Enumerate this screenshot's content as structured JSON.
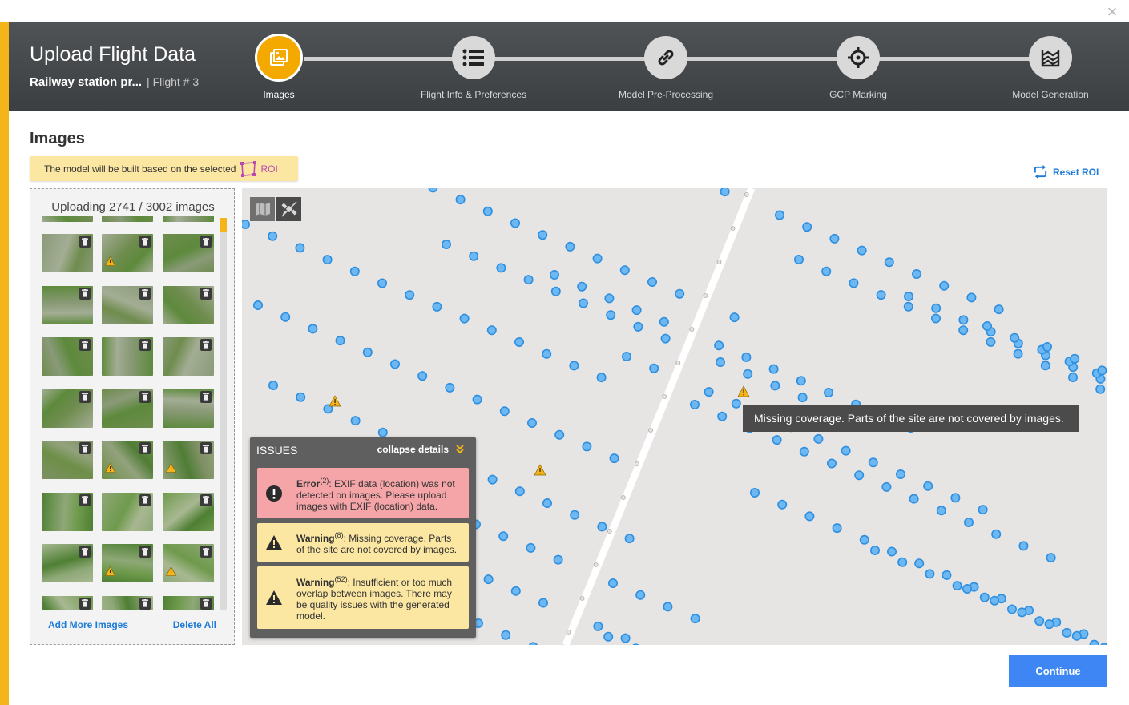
{
  "header": {
    "title": "Upload Flight Data",
    "project_name": "Railway station pr...",
    "flight_label": "| Flight # 3",
    "steps": [
      {
        "label": "Images",
        "icon": "images-icon",
        "active": true
      },
      {
        "label": "Flight Info & Preferences",
        "icon": "list-icon",
        "active": false
      },
      {
        "label": "Model Pre-Processing",
        "icon": "link-icon",
        "active": false
      },
      {
        "label": "GCP Marking",
        "icon": "crosshair-icon",
        "active": false
      },
      {
        "label": "Model Generation",
        "icon": "layers-icon",
        "active": false
      }
    ]
  },
  "content": {
    "section_title": "Images",
    "roi_note": "The model will be built based on the selected",
    "roi_tag": "ROI",
    "reset_roi": "Reset ROI"
  },
  "images_panel": {
    "status": "Uploading 2741 / 3002 images",
    "add_more": "Add More Images",
    "delete_all": "Delete All",
    "rows": [
      {
        "palette": "field",
        "warn": [
          false,
          true,
          false
        ]
      },
      {
        "palette": "field",
        "warn": [
          false,
          false,
          false
        ]
      },
      {
        "palette": "field",
        "warn": [
          false,
          false,
          false
        ]
      },
      {
        "palette": "field",
        "warn": [
          false,
          false,
          false
        ]
      },
      {
        "palette": "mixed",
        "warn": [
          false,
          true,
          true
        ]
      },
      {
        "palette": "bush",
        "warn": [
          false,
          false,
          false
        ]
      },
      {
        "palette": "bush",
        "warn": [
          false,
          true,
          true
        ]
      },
      {
        "palette": "bush",
        "warn": [
          false,
          false,
          false
        ]
      }
    ]
  },
  "map": {
    "tooltip": "Missing coverage. Parts of the site are not covered by images."
  },
  "issues": {
    "title": "ISSUES",
    "collapse_label": "collapse details",
    "error": {
      "label": "Error",
      "count": "(2)",
      "text": ": EXIF data (location) was not detected on images. Please upload images with EXIF (location) data."
    },
    "warning1": {
      "label": "Warning",
      "count": "(8)",
      "text": ": Missing coverage. Parts of the site are not covered by images."
    },
    "warning2": {
      "label": "Warning",
      "count": "(52)",
      "text": ": Insufficient or too much overlap between images. There may be quality issues with the generated model."
    }
  },
  "footer": {
    "continue_label": "Continue"
  },
  "colors": {
    "accent": "#f4b41a",
    "primary_button": "#3d86f4",
    "link": "#1e7bd8",
    "error_bg": "#f5a5a8",
    "warning_bg": "#fbe6a2",
    "flight_dot": "#4fa8ee",
    "roi": "#b94bb0"
  }
}
